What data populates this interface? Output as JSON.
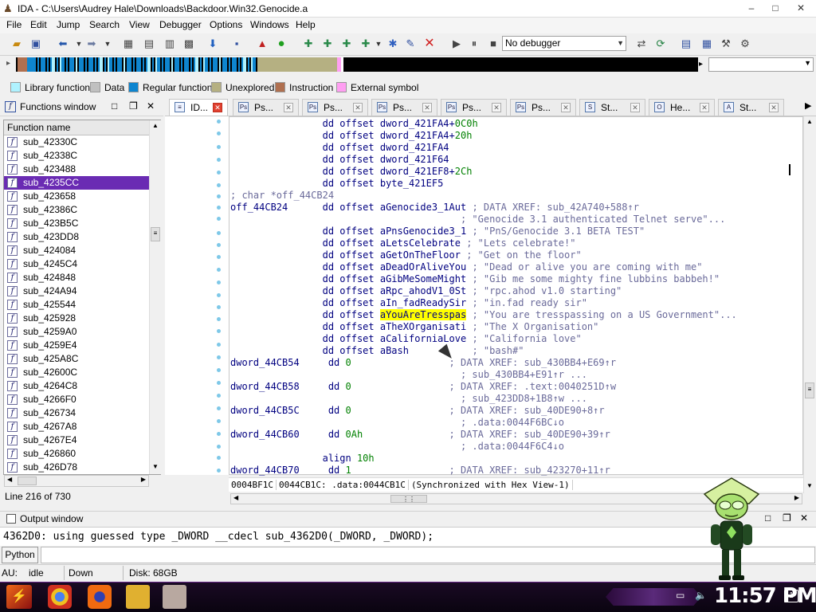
{
  "window": {
    "title": "IDA - C:\\Users\\Audrey Hale\\Downloads\\Backdoor.Win32.Genocide.a",
    "controls": {
      "minimize": "–",
      "maximize": "□",
      "close": "✕"
    }
  },
  "menu": [
    "File",
    "Edit",
    "Jump",
    "Search",
    "View",
    "Debugger",
    "Options",
    "Windows",
    "Help"
  ],
  "toolbar": {
    "debugger_select": "No debugger",
    "icons": [
      "open-icon",
      "save-icon",
      "back-icon",
      "forward-icon",
      "jump-icon",
      "code-icon",
      "run-icon",
      "pause-icon",
      "stop-icon"
    ]
  },
  "legend": [
    {
      "label": "Library function",
      "color": "#aff2ff"
    },
    {
      "label": "Data",
      "color": "#c0c0c0"
    },
    {
      "label": "Regular function",
      "color": "#0e85cf"
    },
    {
      "label": "Unexplored",
      "color": "#b5b082"
    },
    {
      "label": "Instruction",
      "color": "#b07050"
    },
    {
      "label": "External symbol",
      "color": "#ff9ff2"
    }
  ],
  "functions_window": {
    "title": "Functions window",
    "column": "Function name",
    "items": [
      "sub_42330C",
      "sub_42338C",
      "sub_423488",
      "sub_4235CC",
      "sub_423658",
      "sub_42386C",
      "sub_423B5C",
      "sub_423DD8",
      "sub_424084",
      "sub_4245C4",
      "sub_424848",
      "sub_424A94",
      "sub_425544",
      "sub_425928",
      "sub_4259A0",
      "sub_4259E4",
      "sub_425A8C",
      "sub_42600C",
      "sub_4264C8",
      "sub_4266F0",
      "sub_426734",
      "sub_4267A8",
      "sub_4267E4",
      "sub_426860",
      "sub_426D78"
    ],
    "selected_index": 3,
    "status": "Line 216 of 730"
  },
  "tabs": [
    "ID...",
    "Ps...",
    "Ps...",
    "Ps...",
    "Ps...",
    "Ps...",
    "St...",
    "He...",
    "St..."
  ],
  "code": [
    {
      "p1": "                dd offset dword_421FA4+",
      "n": "0C0h",
      "p2": "",
      "c": ""
    },
    {
      "p1": "                dd offset dword_421FA4+",
      "n": "20h",
      "p2": "",
      "c": ""
    },
    {
      "p1": "                dd offset dword_421FA4",
      "n": "",
      "p2": "",
      "c": ""
    },
    {
      "p1": "                dd offset dword_421F64",
      "n": "",
      "p2": "",
      "c": ""
    },
    {
      "p1": "                dd offset dword_421EF8+",
      "n": "2Ch",
      "p2": "",
      "c": ""
    },
    {
      "p1": "                dd offset byte_421EF5",
      "n": "",
      "p2": "",
      "c": ""
    },
    {
      "p1": "",
      "n": "",
      "p2": "",
      "c": "; char *off_44CB24"
    },
    {
      "p1": "off_44CB24      dd offset aGenocide3_1Aut",
      "n": "",
      "p2": "",
      "c": " ; DATA XREF: sub_42A740+588↑r"
    },
    {
      "p1": "",
      "n": "",
      "p2": "",
      "c": "                                        ; \"Genocide 3.1 authenticated Telnet serve\"..."
    },
    {
      "p1": "                dd offset aPnsGenocide3_1",
      "n": "",
      "p2": "",
      "c": " ; \"PnS/Genocide 3.1 BETA TEST\""
    },
    {
      "p1": "                dd offset aLetsCelebrate",
      "n": "",
      "p2": "",
      "c": " ; \"Lets celebrate!\""
    },
    {
      "p1": "                dd offset aGetOnTheFloor",
      "n": "",
      "p2": "",
      "c": " ; \"Get on the floor\""
    },
    {
      "p1": "                dd offset aDeadOrAliveYou",
      "n": "",
      "p2": "",
      "c": " ; \"Dead or alive you are coming with me\""
    },
    {
      "p1": "                dd offset aGibMeSomeMight",
      "n": "",
      "p2": "",
      "c": " ; \"Gib me some mighty fine lubbins babbeh!\""
    },
    {
      "p1": "                dd offset aRpc_ahodV1_0St",
      "n": "",
      "p2": "",
      "c": " ; \"rpc.ahod v1.0 starting\""
    },
    {
      "p1": "                dd offset aIn_fadReadySir",
      "n": "",
      "p2": "",
      "c": " ; \"in.fad ready sir\""
    },
    {
      "p1": "                dd offset ",
      "h": "aYouAreTresspas",
      "n": "",
      "p2": "",
      "c": " ; \"You are tresspassing on a US Government\"..."
    },
    {
      "p1": "                dd offset aTheXOrganisati",
      "n": "",
      "p2": "",
      "c": " ; \"The X Organisation\""
    },
    {
      "p1": "                dd offset aCaliforniaLove",
      "n": "",
      "p2": "",
      "c": " ; \"California love\""
    },
    {
      "p1": "                dd offset aBash",
      "n": "",
      "p2": "",
      "c": "           ; \"bash#\""
    },
    {
      "p1": "dword_44CB54     dd ",
      "n": "0",
      "p2": "",
      "c": "                 ; DATA XREF: sub_430BB4+E69↑r"
    },
    {
      "p1": "",
      "n": "",
      "p2": "",
      "c": "                                        ; sub_430BB4+E91↑r ..."
    },
    {
      "p1": "dword_44CB58     dd ",
      "n": "0",
      "p2": "",
      "c": "                 ; DATA XREF: .text:0040251D↑w"
    },
    {
      "p1": "",
      "n": "",
      "p2": "",
      "c": "                                        ; sub_423DD8+1B8↑w ..."
    },
    {
      "p1": "dword_44CB5C     dd ",
      "n": "0",
      "p2": "",
      "c": "                 ; DATA XREF: sub_40DE90+8↑r"
    },
    {
      "p1": "",
      "n": "",
      "p2": "",
      "c": "                                        ; .data:0044F6BC↓o"
    },
    {
      "p1": "dword_44CB60     dd ",
      "n": "0Ah",
      "p2": "",
      "c": "               ; DATA XREF: sub_40DE90+39↑r"
    },
    {
      "p1": "",
      "n": "",
      "p2": "",
      "c": "                                        ; .data:0044F6C4↓o"
    },
    {
      "p1": "                align ",
      "n": "10h",
      "p2": "",
      "c": ""
    },
    {
      "p1": "dword_44CB70     dd ",
      "n": "1",
      "p2": "",
      "c": "                 ; DATA XREF: sub_423270+11↑r"
    }
  ],
  "syncbar": {
    "offset": "0004BF1C",
    "address": "0044CB1C: .data:0044CB1C",
    "note": "(Synchronized with Hex View-1)"
  },
  "output": {
    "title": "Output window",
    "text": "4362D0: using guessed type _DWORD __cdecl sub_4362D0(_DWORD, _DWORD);",
    "python_button": "Python"
  },
  "status": {
    "au": "AU:",
    "state": "idle",
    "direction": "Down",
    "disk": "Disk: 68GB"
  },
  "taskbar": {
    "clock": "11:57 PM"
  }
}
